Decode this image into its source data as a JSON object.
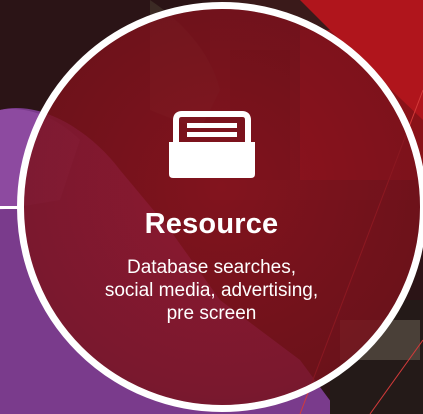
{
  "card": {
    "title": "Resource",
    "description_lines": [
      "Database searches,",
      "social media, advertising,",
      "pre screen"
    ],
    "icon": "inbox-tray-icon",
    "colors": {
      "overlay": "#8c1420",
      "border": "#ffffff",
      "text": "#ffffff",
      "shirt": "#7a3b8c"
    }
  }
}
